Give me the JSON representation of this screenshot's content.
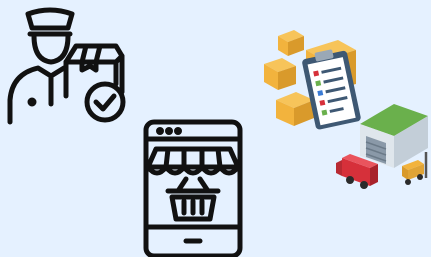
{
  "illustrations": [
    {
      "name": "delivery-courier-icon",
      "style": "line-art"
    },
    {
      "name": "online-store-tablet-icon",
      "style": "line-art"
    },
    {
      "name": "inventory-boxes-clipboard-icon",
      "style": "flat-color"
    },
    {
      "name": "warehouse-forklift-truck-icon",
      "style": "flat-color"
    }
  ],
  "colors": {
    "background": "#e5f1ff",
    "line": "#111111",
    "box": "#f2b33d",
    "box_shade": "#d99a2b",
    "clipboard": "#3e5873",
    "roof": "#6ab04c",
    "truck": "#d6303a"
  }
}
